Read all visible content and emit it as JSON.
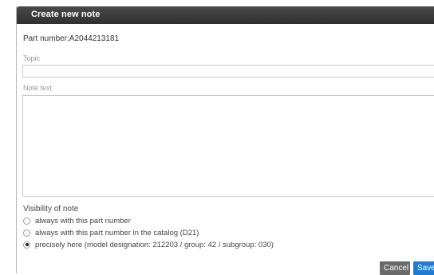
{
  "dialog": {
    "title": "Create new note",
    "part_number": "Part number:A2044213181",
    "topic_label": "Topic",
    "topic_value": "",
    "note_label": "Note text",
    "note_value": "",
    "visibility": {
      "label": "Visibility of note",
      "options": [
        {
          "label": "always with this part number",
          "selected": false
        },
        {
          "label": "always with this part number in the catalog (D21)",
          "selected": false
        },
        {
          "label": "precisely here (model designation: 212203 / group: 42 / subgroup: 030)",
          "selected": true
        }
      ]
    },
    "buttons": {
      "cancel": "Cancel",
      "save": "Save"
    }
  },
  "colors": {
    "titlebar": "#333333",
    "cancel": "#6a6a6a",
    "save": "#1f7bd0"
  }
}
